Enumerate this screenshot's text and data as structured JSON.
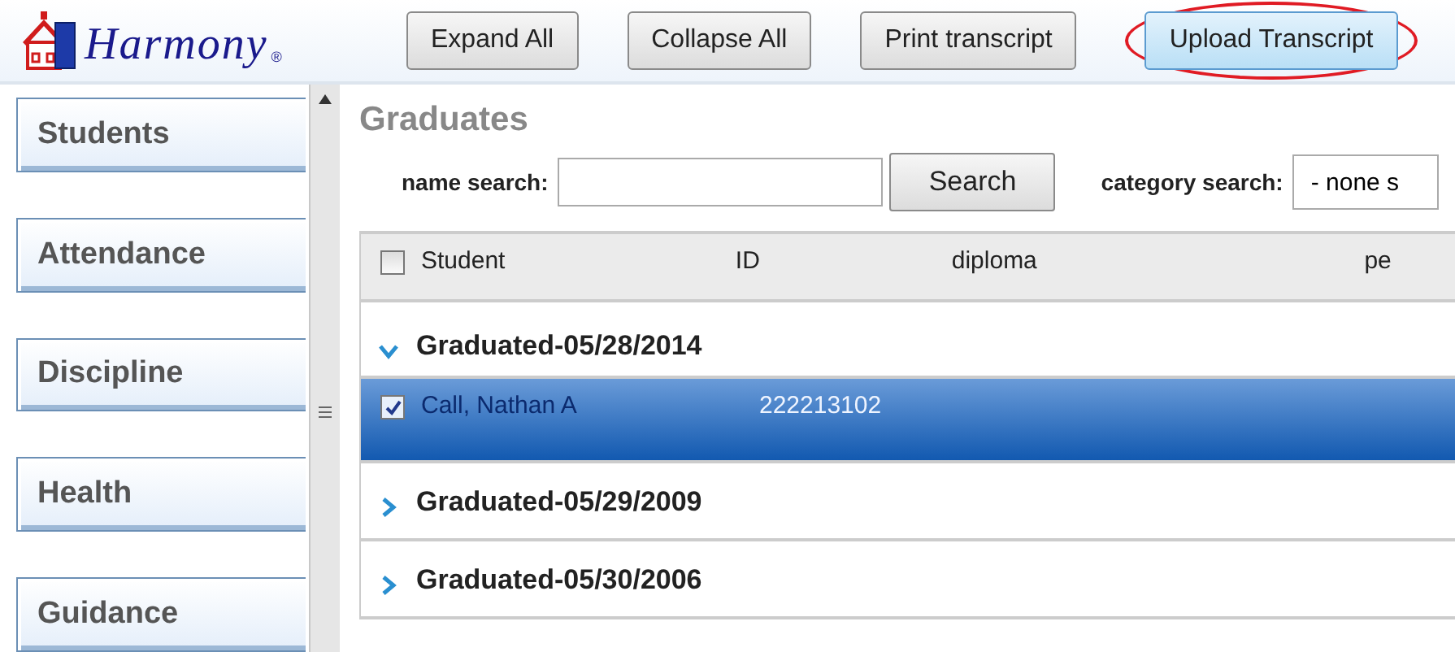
{
  "logo": {
    "text": "Harmony",
    "mark": "®"
  },
  "toolbar": [
    {
      "label": "Expand All",
      "highlighted": false
    },
    {
      "label": "Collapse All",
      "highlighted": false
    },
    {
      "label": "Print transcript",
      "highlighted": false
    },
    {
      "label": "Upload Transcript",
      "highlighted": true
    }
  ],
  "sidebar": {
    "items": [
      {
        "label": "Students"
      },
      {
        "label": "Attendance"
      },
      {
        "label": "Discipline"
      },
      {
        "label": "Health"
      },
      {
        "label": "Guidance"
      }
    ]
  },
  "page_title": "Graduates",
  "name_search": {
    "label": "name search:",
    "button": "Search"
  },
  "category_search": {
    "label": "category search:",
    "value": "- none s"
  },
  "table": {
    "select_all_checked": false,
    "columns": [
      "Student",
      "ID",
      "diploma",
      "pe"
    ],
    "groups": [
      {
        "title": "Graduated-05/28/2014",
        "expanded": true,
        "rows": [
          {
            "student": "Call, Nathan A",
            "id": "222213102",
            "checked": true,
            "selected": true
          }
        ]
      },
      {
        "title": "Graduated-05/29/2009",
        "expanded": false
      },
      {
        "title": "Graduated-05/30/2006",
        "expanded": false
      }
    ]
  }
}
